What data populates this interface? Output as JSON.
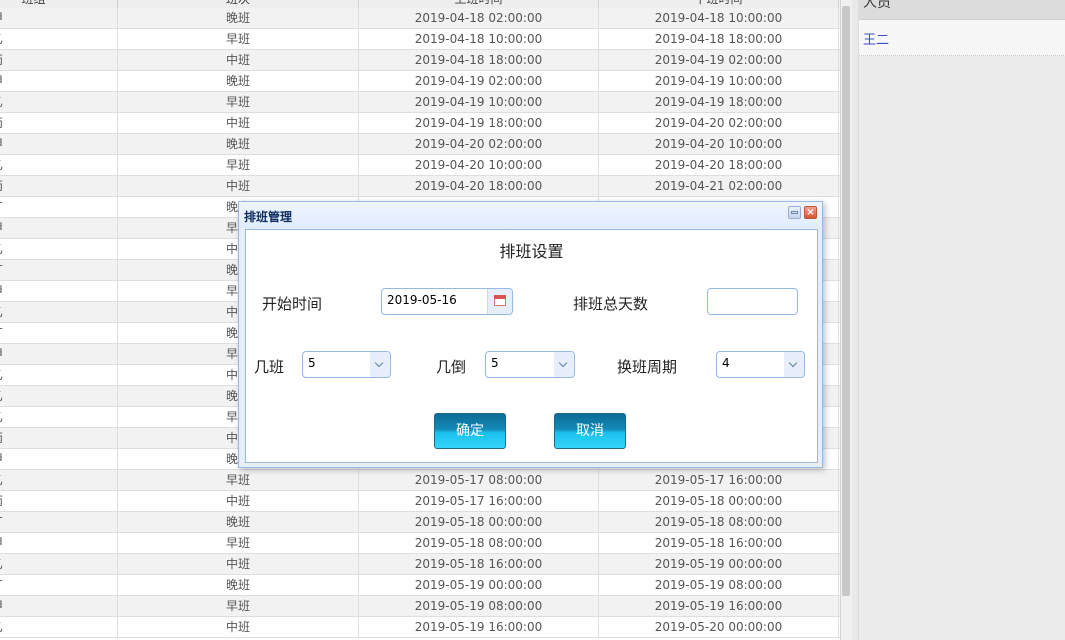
{
  "grid": {
    "header": [
      "班组",
      "班次",
      "上班时间",
      "下班时间"
    ],
    "rows": [
      {
        "team": "甲",
        "shift": "晚班",
        "start": "2019-04-18 02:00:00",
        "end": "2019-04-18 10:00:00"
      },
      {
        "team": "乙",
        "shift": "早班",
        "start": "2019-04-18 10:00:00",
        "end": "2019-04-18 18:00:00"
      },
      {
        "team": "丙",
        "shift": "中班",
        "start": "2019-04-18 18:00:00",
        "end": "2019-04-19 02:00:00"
      },
      {
        "team": "甲",
        "shift": "晚班",
        "start": "2019-04-19 02:00:00",
        "end": "2019-04-19 10:00:00"
      },
      {
        "team": "乙",
        "shift": "早班",
        "start": "2019-04-19 10:00:00",
        "end": "2019-04-19 18:00:00"
      },
      {
        "team": "丙",
        "shift": "中班",
        "start": "2019-04-19 18:00:00",
        "end": "2019-04-20 02:00:00"
      },
      {
        "team": "甲",
        "shift": "晚班",
        "start": "2019-04-20 02:00:00",
        "end": "2019-04-20 10:00:00"
      },
      {
        "team": "乙",
        "shift": "早班",
        "start": "2019-04-20 10:00:00",
        "end": "2019-04-20 18:00:00"
      },
      {
        "team": "丙",
        "shift": "中班",
        "start": "2019-04-20 18:00:00",
        "end": "2019-04-21 02:00:00"
      },
      {
        "team": "丁",
        "shift": "晚班",
        "start": "",
        "end": ""
      },
      {
        "team": "甲",
        "shift": "早班",
        "start": "",
        "end": ""
      },
      {
        "team": "乙",
        "shift": "中班",
        "start": "",
        "end": ""
      },
      {
        "team": "丁",
        "shift": "晚班",
        "start": "",
        "end": ""
      },
      {
        "team": "甲",
        "shift": "早班",
        "start": "",
        "end": ""
      },
      {
        "team": "乙",
        "shift": "中班",
        "start": "",
        "end": ""
      },
      {
        "team": "丁",
        "shift": "晚班",
        "start": "",
        "end": ""
      },
      {
        "team": "甲",
        "shift": "早班",
        "start": "",
        "end": ""
      },
      {
        "team": "乙",
        "shift": "中班",
        "start": "",
        "end": ""
      },
      {
        "team": "乙",
        "shift": "晚班",
        "start": "",
        "end": ""
      },
      {
        "team": "乙",
        "shift": "早班",
        "start": "",
        "end": ""
      },
      {
        "team": "丙",
        "shift": "中班",
        "start": "",
        "end": ""
      },
      {
        "team": "甲",
        "shift": "晚班",
        "start": "",
        "end": ""
      },
      {
        "team": "乙",
        "shift": "早班",
        "start": "2019-05-17 08:00:00",
        "end": "2019-05-17 16:00:00"
      },
      {
        "team": "丙",
        "shift": "中班",
        "start": "2019-05-17 16:00:00",
        "end": "2019-05-18 00:00:00"
      },
      {
        "team": "丁",
        "shift": "晚班",
        "start": "2019-05-18 00:00:00",
        "end": "2019-05-18 08:00:00"
      },
      {
        "team": "甲",
        "shift": "早班",
        "start": "2019-05-18 08:00:00",
        "end": "2019-05-18 16:00:00"
      },
      {
        "team": "乙",
        "shift": "中班",
        "start": "2019-05-18 16:00:00",
        "end": "2019-05-19 00:00:00"
      },
      {
        "team": "丁",
        "shift": "晚班",
        "start": "2019-05-19 00:00:00",
        "end": "2019-05-19 08:00:00"
      },
      {
        "team": "甲",
        "shift": "早班",
        "start": "2019-05-19 08:00:00",
        "end": "2019-05-19 16:00:00"
      },
      {
        "team": "乙",
        "shift": "中班",
        "start": "2019-05-19 16:00:00",
        "end": "2019-05-20 00:00:00"
      }
    ]
  },
  "right_panel": {
    "header": "人员",
    "items": [
      "王二"
    ]
  },
  "dialog": {
    "title": "排班管理",
    "heading": "排班设置",
    "start_time_label": "开始时间",
    "start_time_value": "2019-05-16",
    "total_days_label": "排班总天数",
    "total_days_value": "",
    "shifts_label": "几班",
    "shifts_value": "5",
    "rotations_label": "几倒",
    "rotations_value": "5",
    "cycle_label": "换班周期",
    "cycle_value": "4",
    "confirm_label": "确定",
    "cancel_label": "取消",
    "close_glyph": "×"
  },
  "icons": {
    "calendar": "calendar-icon",
    "dropdown": "chevron-down-icon",
    "minimize": "minimize-icon",
    "close": "close-icon"
  },
  "colors": {
    "dialog_border": "#95b8e7",
    "button_gradient_top": "#0d6c94",
    "button_gradient_bottom": "#34d5f8",
    "person_link": "#3a4fc9"
  }
}
